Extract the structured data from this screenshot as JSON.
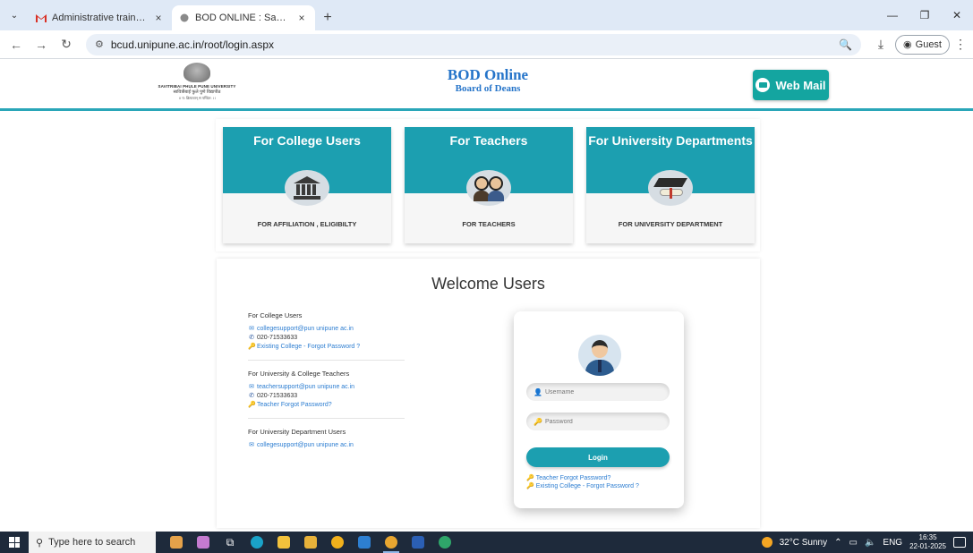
{
  "browser": {
    "tabs": [
      {
        "title": "Administrative training Program",
        "close": "×"
      },
      {
        "title": "BOD ONLINE : SavitriBai Phule Pune University",
        "close": "×"
      }
    ],
    "new_tab": "+",
    "url": "bcud.unipune.ac.in/root/login.aspx",
    "profile_label": "Guest"
  },
  "header": {
    "logo_line1": "SAVITRIBAI PHULE PUNE UNIVERSITY",
    "logo_line2": "सावित्रीबाई फुले पुणे विद्यापीठ",
    "logo_line3": "।। य: क्रियावान् स पण्डित: ।।",
    "brand_title": "BOD Online",
    "brand_subtitle": "Board of Deans",
    "webmail_label": "Web Mail",
    "accent_color": "#2aa6b8"
  },
  "cards": [
    {
      "title": "For College Users",
      "caption": "FOR AFFILIATION , ELIGIBILTY",
      "icon": "bank-icon"
    },
    {
      "title": "For Teachers",
      "caption": "FOR TEACHERS",
      "icon": "teachers-icon"
    },
    {
      "title": "For University Departments",
      "caption": "FOR UNIVERSITY DEPARTMENT",
      "icon": "graduation-cap-icon"
    }
  ],
  "welcome_title": "Welcome Users",
  "contacts": [
    {
      "title": "For College Users",
      "email": "collegesupport@pun unipune ac.in",
      "phone": "020-71533633",
      "link": "Existing College - Forgot Password ?"
    },
    {
      "title": "For University & College Teachers",
      "email": "teachersupport@pun unipune ac.in",
      "phone": "020-71533633",
      "link": "Teacher Forgot Password?"
    },
    {
      "title": "For University Department Users",
      "email": "collegesupport@pun unipune ac.in"
    }
  ],
  "login": {
    "username_placeholder": "Username",
    "password_placeholder": "Password",
    "button_label": "Login",
    "link_teacher": "Teacher Forgot Password?",
    "link_college": "Existing College - Forgot Password ?"
  },
  "taskbar": {
    "search_placeholder": "Type here to search",
    "weather": "32°C Sunny",
    "language": "ENG",
    "time": "16:35",
    "date": "22-01-2025"
  }
}
